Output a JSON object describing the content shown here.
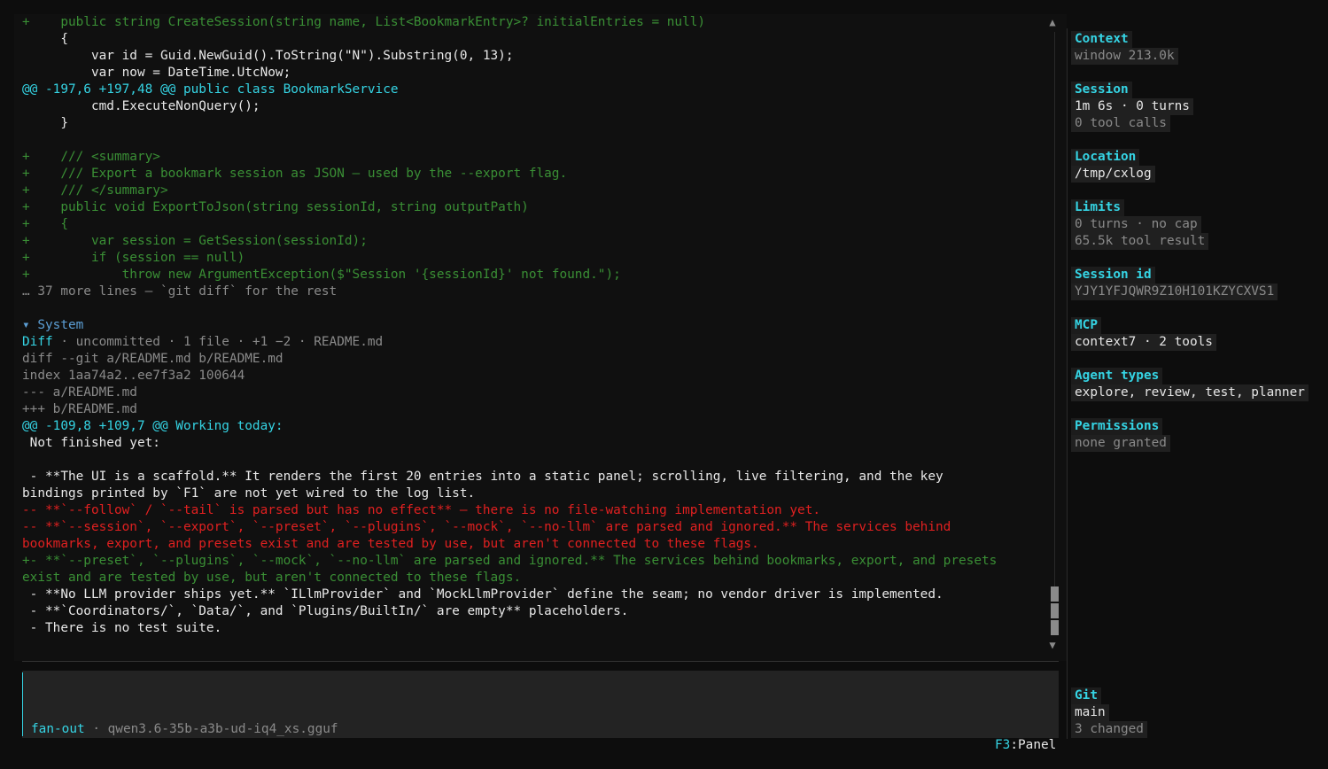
{
  "transcript": {
    "lines": [
      {
        "text": "+    public string CreateSession(string name, List<BookmarkEntry>? initialEntries = null)",
        "style": "green"
      },
      {
        "text": "     {",
        "style": "white"
      },
      {
        "text": "         var id = Guid.NewGuid().ToString(\"N\").Substring(0, 13);",
        "style": "white"
      },
      {
        "text": "         var now = DateTime.UtcNow;",
        "style": "white"
      },
      {
        "text": "@@ -197,6 +197,48 @@ public class BookmarkService",
        "style": "cyan"
      },
      {
        "text": "         cmd.ExecuteNonQuery();",
        "style": "white"
      },
      {
        "text": "     }",
        "style": "white"
      },
      {
        "text": "",
        "style": "white"
      },
      {
        "text": "+    /// <summary>",
        "style": "green"
      },
      {
        "text": "+    /// Export a bookmark session as JSON — used by the --export flag.",
        "style": "green"
      },
      {
        "text": "+    /// </summary>",
        "style": "green"
      },
      {
        "text": "+    public void ExportToJson(string sessionId, string outputPath)",
        "style": "green"
      },
      {
        "text": "+    {",
        "style": "green"
      },
      {
        "text": "+        var session = GetSession(sessionId);",
        "style": "green"
      },
      {
        "text": "+        if (session == null)",
        "style": "green"
      },
      {
        "text": "+            throw new ArgumentException($\"Session '{sessionId}' not found.\");",
        "style": "green"
      },
      {
        "text": "… 37 more lines — `git diff` for the rest",
        "style": "gray"
      },
      {
        "text": "",
        "style": "white"
      },
      {
        "text": "▾ System",
        "style": "sys"
      },
      {
        "text": "",
        "style": "diffhdr"
      },
      {
        "text": "diff --git a/README.md b/README.md",
        "style": "gray"
      },
      {
        "text": "index 1aa74a2..ee7f3a2 100644",
        "style": "gray"
      },
      {
        "text": "--- a/README.md",
        "style": "gray"
      },
      {
        "text": "+++ b/README.md",
        "style": "gray"
      },
      {
        "text": "@@ -109,8 +109,7 @@ Working today:",
        "style": "cyan"
      },
      {
        "text": " Not finished yet:",
        "style": "white"
      },
      {
        "text": "",
        "style": "white"
      },
      {
        "text": " - **The UI is a scaffold.** It renders the first 20 entries into a static panel; scrolling, live filtering, and the key",
        "style": "white"
      },
      {
        "text": "bindings printed by `F1` are not yet wired to the log list.",
        "style": "white"
      },
      {
        "text": "-- **`--follow` / `--tail` is parsed but has no effect** — there is no file-watching implementation yet.",
        "style": "red"
      },
      {
        "text": "-- **`--session`, `--export`, `--preset`, `--plugins`, `--mock`, `--no-llm` are parsed and ignored.** The services behind",
        "style": "red"
      },
      {
        "text": "bookmarks, export, and presets exist and are tested by use, but aren't connected to these flags.",
        "style": "red"
      },
      {
        "text": "+- **`--preset`, `--plugins`, `--mock`, `--no-llm` are parsed and ignored.** The services behind bookmarks, export, and presets",
        "style": "green"
      },
      {
        "text": "exist and are tested by use, but aren't connected to these flags.",
        "style": "green"
      },
      {
        "text": " - **No LLM provider ships yet.** `ILlmProvider` and `MockLlmProvider` define the seam; no vendor driver is implemented.",
        "style": "white"
      },
      {
        "text": " - **`Coordinators/`, `Data/`, and `Plugins/BuiltIn/` are empty** placeholders.",
        "style": "white"
      },
      {
        "text": " - There is no test suite.",
        "style": "white"
      }
    ],
    "diff_header": {
      "label": "Diff",
      "detail": " · uncommitted · 1 file · +1 −2 · README.md"
    },
    "scroll_up_glyph": "▲",
    "scroll_down_glyph": "▼"
  },
  "input": {
    "mode": "fan-out",
    "model": " · qwen3.6-35b-a3b-ud-iq4_xs.gguf"
  },
  "footer": {
    "key": "F3",
    "label": ":Panel"
  },
  "panel": {
    "context": {
      "title": "Context",
      "value": "window 213.0k"
    },
    "session": {
      "title": "Session",
      "line1": "1m 6s · 0 turns",
      "line2": "0 tool calls"
    },
    "location": {
      "title": "Location",
      "value": "/tmp/cxlog"
    },
    "limits": {
      "title": "Limits",
      "line1": "0 turns · no cap",
      "line2": "65.5k tool result"
    },
    "session_id": {
      "title": "Session id",
      "value": "YJY1YFJQWR9Z10H101KZYCXVS1"
    },
    "mcp": {
      "title": "MCP",
      "value": "context7 · 2 tools"
    },
    "agent_types": {
      "title": "Agent types",
      "value": "explore, review, test, planner"
    },
    "permissions": {
      "title": "Permissions",
      "value": "none granted"
    },
    "git": {
      "title": "Git",
      "branch": "main",
      "changed": "3 changed"
    }
  },
  "colors": {
    "accent": "#35d4e4",
    "added": "#3a8f35",
    "removed": "#e02020",
    "dim": "#8a8a8a",
    "background": "#0d0d0d"
  }
}
